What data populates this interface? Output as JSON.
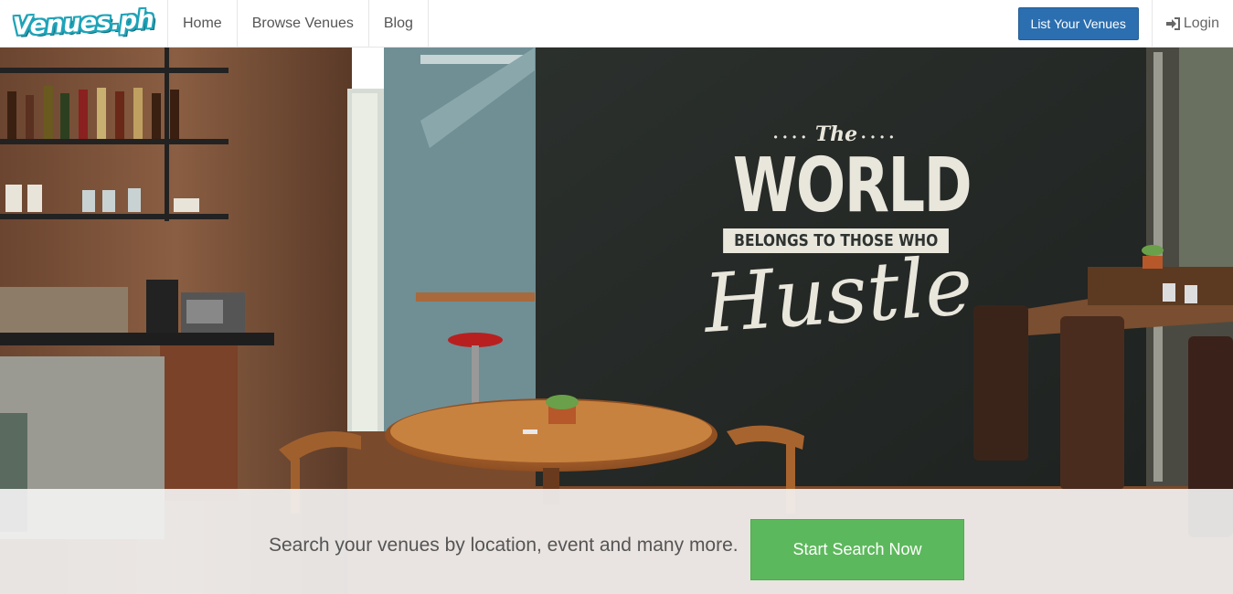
{
  "brand": {
    "name": "Venues.ph"
  },
  "nav": {
    "items": [
      {
        "label": "Home"
      },
      {
        "label": "Browse Venues"
      },
      {
        "label": "Blog"
      }
    ],
    "cta_label": "List Your Venues",
    "login_label": "Login"
  },
  "hero": {
    "chalkboard": {
      "the": "The",
      "world": "WORLD",
      "banner": "BELONGS TO THOSE WHO",
      "hustle": "Hustle"
    }
  },
  "search": {
    "tagline": "Search your venues by location, event and many more.",
    "button_label": "Start Search Now"
  },
  "colors": {
    "cta": "#2c6fb0",
    "search_button": "#5cb85c",
    "brand": "#1fa3b8"
  }
}
